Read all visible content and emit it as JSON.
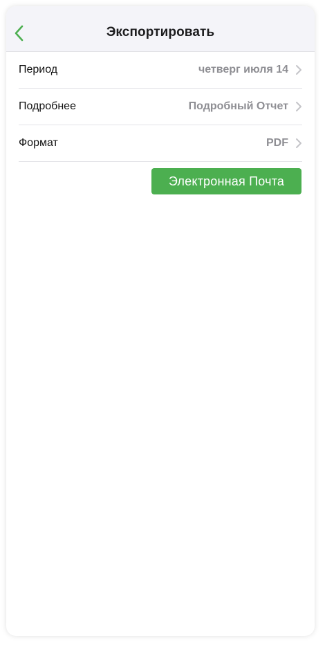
{
  "header": {
    "title": "Экспортировать",
    "back_icon": "chevron-left-icon",
    "accent_color": "#4caf50"
  },
  "settings": {
    "rows": [
      {
        "label": "Период",
        "value": "четверг июля 14"
      },
      {
        "label": "Подробнее",
        "value": "Подробный Отчет"
      },
      {
        "label": "Формат",
        "value": "PDF"
      }
    ],
    "chevron_icon": "chevron-right-icon"
  },
  "actions": {
    "email_label": "Электронная Почта",
    "email_color": "#4caf50"
  }
}
